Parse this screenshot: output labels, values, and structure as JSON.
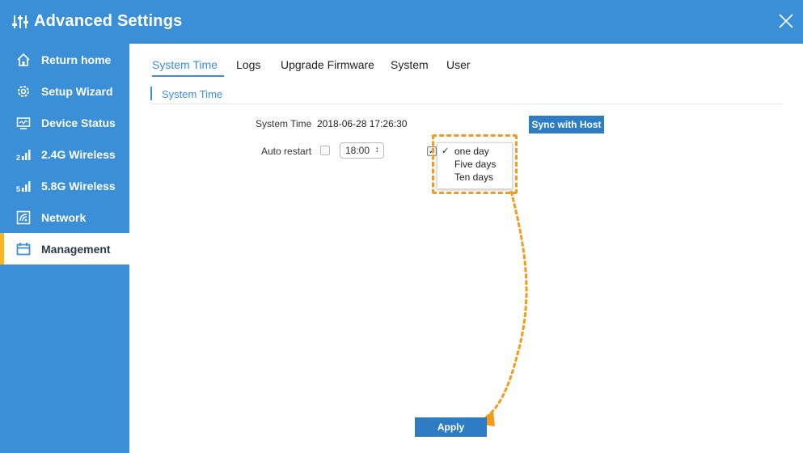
{
  "window": {
    "title": "Advanced Settings",
    "title_icon": "sliders-icon",
    "close_icon": "close-icon"
  },
  "sidebar": {
    "items": [
      {
        "label": "Return home",
        "icon": "home-icon",
        "active": false
      },
      {
        "label": "Setup Wizard",
        "icon": "gear-icon",
        "active": false
      },
      {
        "label": "Device Status",
        "icon": "monitor-icon",
        "active": false
      },
      {
        "label": "2.4G Wireless",
        "icon": "signal-2g-icon",
        "active": false
      },
      {
        "label": "5.8G Wireless",
        "icon": "signal-5g-icon",
        "active": false
      },
      {
        "label": "Network",
        "icon": "network-icon",
        "active": false
      },
      {
        "label": "Management",
        "icon": "calendar-icon",
        "active": true
      }
    ]
  },
  "tabs": [
    {
      "label": "System Time",
      "active": true
    },
    {
      "label": "Logs",
      "active": false
    },
    {
      "label": "Upgrade Firmware",
      "active": false
    },
    {
      "label": "System",
      "active": false
    },
    {
      "label": "User",
      "active": false
    }
  ],
  "section": {
    "title": "System Time"
  },
  "form": {
    "system_time_label": "System Time",
    "system_time_value": "2018-06-28 17:26:30",
    "sync_button": "Sync with Host",
    "auto_restart_label": "Auto restart",
    "auto_restart_checked": false,
    "restart_time": "18:00",
    "interval_checked": true,
    "interval_options": [
      {
        "label": "one day",
        "selected": true
      },
      {
        "label": "Five days",
        "selected": false
      },
      {
        "label": "Ten days",
        "selected": false
      }
    ],
    "apply_button": "Apply"
  },
  "colors": {
    "accent": "#3a8fd6",
    "button": "#2d7cc4",
    "active_marker": "#f5b820",
    "annotation": "#f29b1e"
  }
}
